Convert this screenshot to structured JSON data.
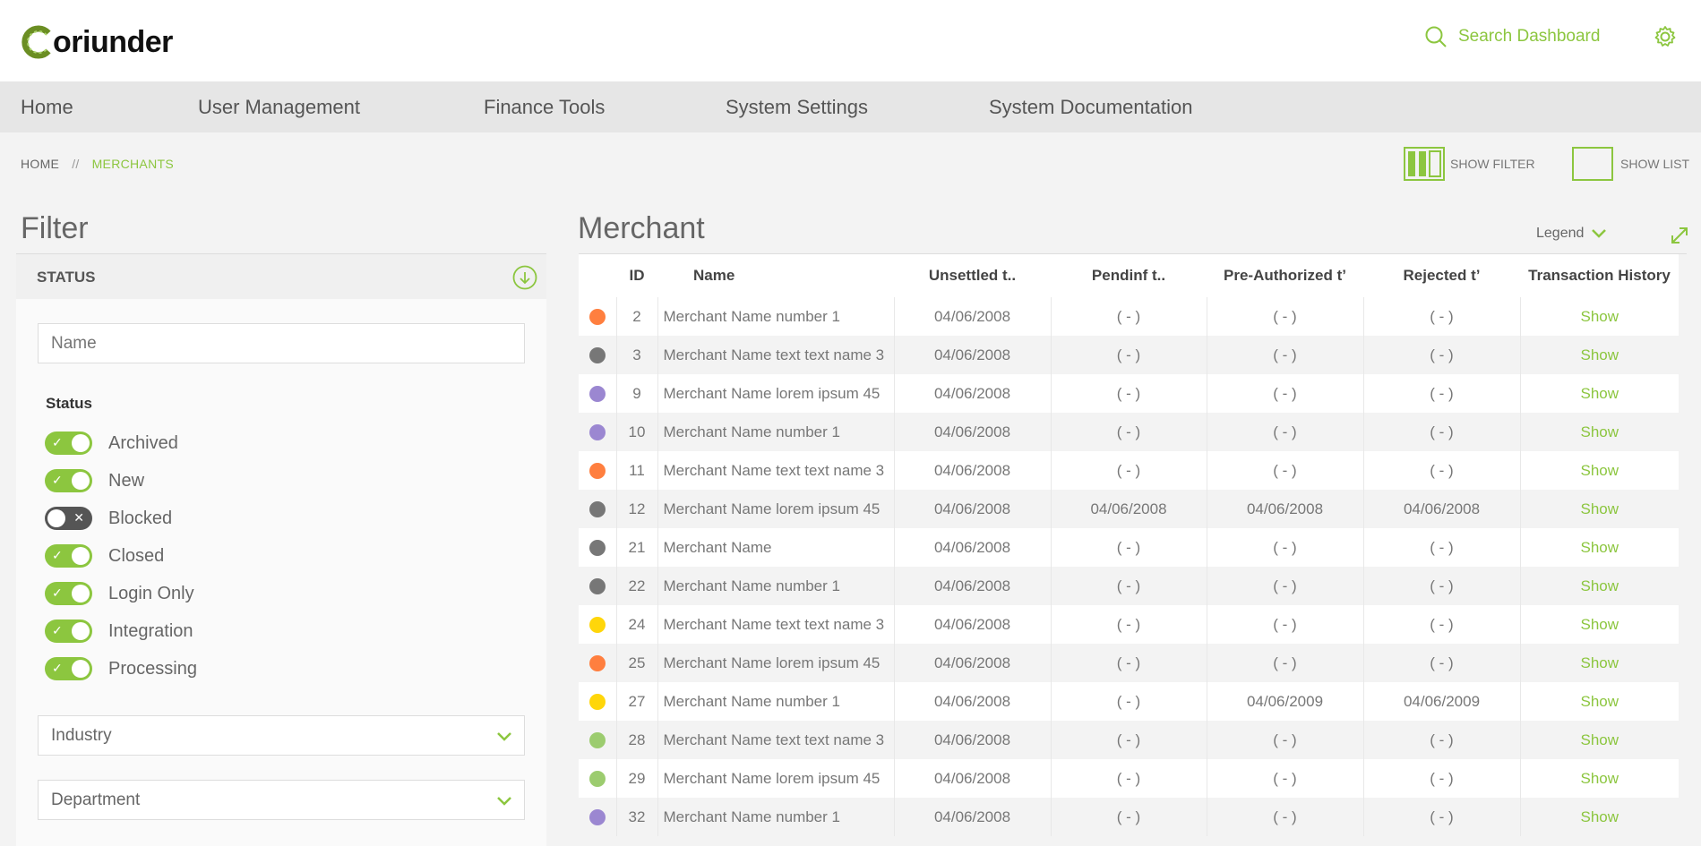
{
  "header": {
    "logo_text": "oriunder",
    "search_placeholder": "Search Dashboard"
  },
  "nav": {
    "items": [
      {
        "label": "Home"
      },
      {
        "label": "User Management"
      },
      {
        "label": "Finance Tools"
      },
      {
        "label": "System Settings"
      },
      {
        "label": "System Documentation"
      }
    ]
  },
  "breadcrumb": {
    "home": "HOME",
    "separator": "//",
    "current": "MERCHANTS"
  },
  "view_buttons": {
    "show_filter": "SHOW FILTER",
    "show_list": "SHOW LIST"
  },
  "filter": {
    "title": "Filter",
    "section_label": "STATUS",
    "name_placeholder": "Name",
    "status_label": "Status",
    "toggles": [
      {
        "label": "Archived",
        "on": true
      },
      {
        "label": "New",
        "on": true
      },
      {
        "label": "Blocked",
        "on": false
      },
      {
        "label": "Closed",
        "on": true
      },
      {
        "label": "Login Only",
        "on": true
      },
      {
        "label": "Integration",
        "on": true
      },
      {
        "label": "Processing",
        "on": true
      }
    ],
    "industry": "Industry",
    "department": "Department"
  },
  "merchant": {
    "title": "Merchant",
    "legend": "Legend",
    "columns": [
      "ID",
      "Name",
      "Unsettled t..",
      "Pendinf t..",
      "Pre-Authorized t’",
      "Rejected t’",
      "Transaction History"
    ],
    "rows": [
      {
        "color": "#ff7f3f",
        "id": "2",
        "name": "Merchant Name number 1",
        "unsettled": "04/06/2008",
        "pending": "( - )",
        "preauth": "( - )",
        "rejected": "( - )",
        "history": "Show"
      },
      {
        "color": "#777777",
        "id": "3",
        "name": "Merchant Name text text name 3",
        "unsettled": "04/06/2008",
        "pending": "( - )",
        "preauth": "( - )",
        "rejected": "( - )",
        "history": "Show"
      },
      {
        "color": "#9b87d1",
        "id": "9",
        "name": "Merchant Name lorem ipsum 45",
        "unsettled": "04/06/2008",
        "pending": "( - )",
        "preauth": "( - )",
        "rejected": "( - )",
        "history": "Show"
      },
      {
        "color": "#9b87d1",
        "id": "10",
        "name": "Merchant Name number 1",
        "unsettled": "04/06/2008",
        "pending": "( - )",
        "preauth": "( - )",
        "rejected": "( - )",
        "history": "Show"
      },
      {
        "color": "#ff7f3f",
        "id": "11",
        "name": "Merchant Name text text name 3",
        "unsettled": "04/06/2008",
        "pending": "( - )",
        "preauth": "( - )",
        "rejected": "( - )",
        "history": "Show"
      },
      {
        "color": "#777777",
        "id": "12",
        "name": "Merchant Name lorem ipsum 45",
        "unsettled": "04/06/2008",
        "pending": "04/06/2008",
        "preauth": "04/06/2008",
        "rejected": "04/06/2008",
        "history": "Show"
      },
      {
        "color": "#777777",
        "id": "21",
        "name": "Merchant Name",
        "unsettled": "04/06/2008",
        "pending": "( - )",
        "preauth": "( - )",
        "rejected": "( - )",
        "history": "Show"
      },
      {
        "color": "#777777",
        "id": "22",
        "name": "Merchant Name number 1",
        "unsettled": "04/06/2008",
        "pending": "( - )",
        "preauth": "( - )",
        "rejected": "( - )",
        "history": "Show"
      },
      {
        "color": "#ffd60a",
        "id": "24",
        "name": "Merchant Name text text name 3",
        "unsettled": "04/06/2008",
        "pending": "( - )",
        "preauth": "( - )",
        "rejected": "( - )",
        "history": "Show"
      },
      {
        "color": "#ff7f3f",
        "id": "25",
        "name": "Merchant Name lorem ipsum 45",
        "unsettled": "04/06/2008",
        "pending": "( - )",
        "preauth": "( - )",
        "rejected": "( - )",
        "history": "Show"
      },
      {
        "color": "#ffd60a",
        "id": "27",
        "name": "Merchant Name number 1",
        "unsettled": "04/06/2008",
        "pending": "( - )",
        "preauth": "04/06/2009",
        "rejected": "04/06/2009",
        "history": "Show"
      },
      {
        "color": "#9ccc6f",
        "id": "28",
        "name": "Merchant Name text text name 3",
        "unsettled": "04/06/2008",
        "pending": "( - )",
        "preauth": "( - )",
        "rejected": "( - )",
        "history": "Show"
      },
      {
        "color": "#9ccc6f",
        "id": "29",
        "name": "Merchant Name lorem ipsum 45",
        "unsettled": "04/06/2008",
        "pending": "( - )",
        "preauth": "( - )",
        "rejected": "( - )",
        "history": "Show"
      },
      {
        "color": "#9b87d1",
        "id": "32",
        "name": "Merchant Name number 1",
        "unsettled": "04/06/2008",
        "pending": "( - )",
        "preauth": "( - )",
        "rejected": "( - )",
        "history": "Show"
      }
    ]
  },
  "colors": {
    "accent": "#8cc63f"
  }
}
